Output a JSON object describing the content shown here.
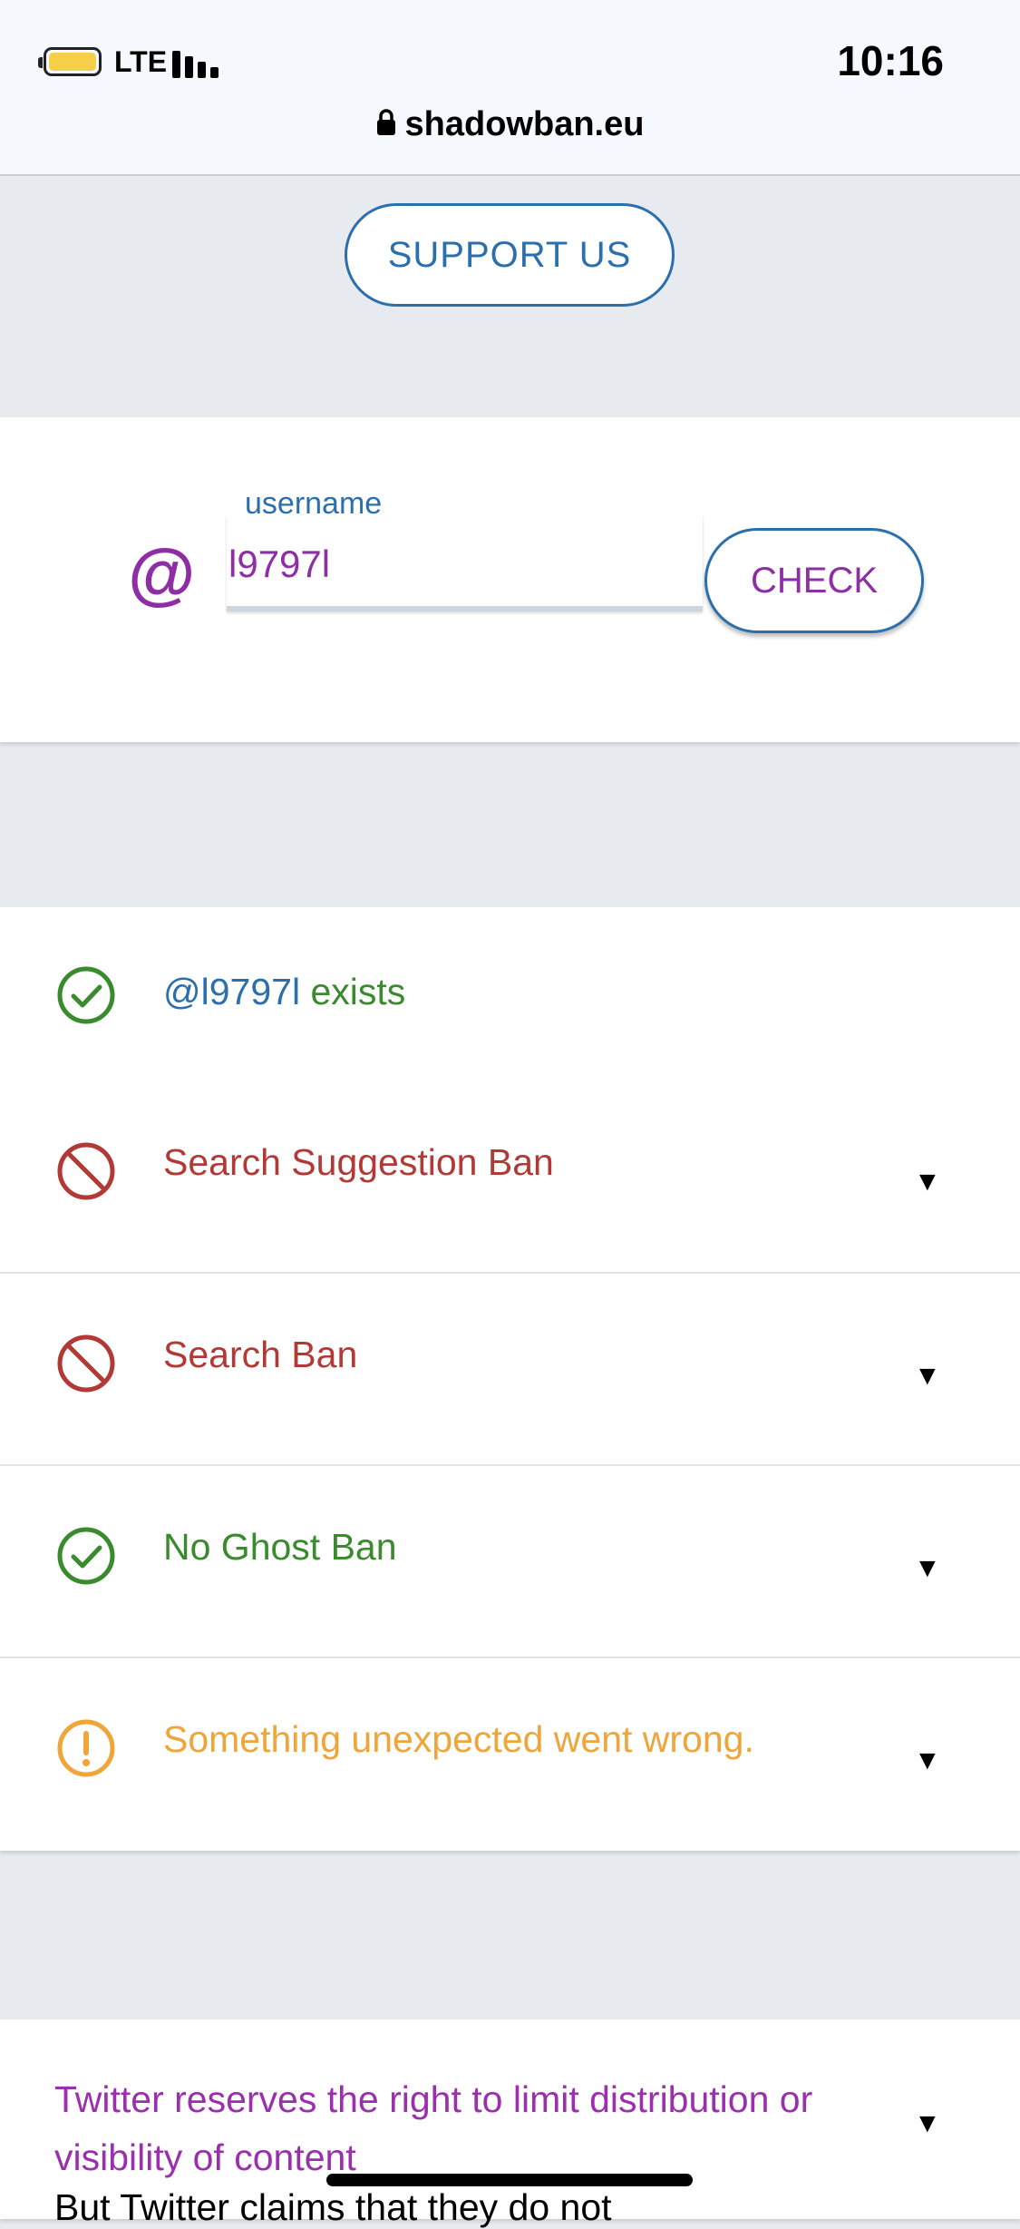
{
  "status_bar": {
    "carrier": "LTE",
    "time": "10:16"
  },
  "browser": {
    "url": "shadowban.eu"
  },
  "support_button": {
    "label": "SUPPORT US"
  },
  "username_form": {
    "at_symbol": "@",
    "field_label": "username",
    "value": "l9797l",
    "check_label": "CHECK"
  },
  "results": [
    {
      "label": "@l9797l exists",
      "status": "ok"
    },
    {
      "label": "Search Suggestion Ban",
      "status": "ban"
    },
    {
      "label": "Search Ban",
      "status": "ban"
    },
    {
      "label": "No Ghost Ban",
      "status": "ok"
    },
    {
      "label": "Something unexpected went wrong.",
      "status": "warning"
    }
  ],
  "exists_parts": {
    "handle": "@l9797l",
    "suffix": " exists"
  },
  "expand_arrow": "▼",
  "footer_card": {
    "text": "Twitter reserves the right to limit distribution or visibility of content",
    "subtext": "But Twitter claims that they do not"
  },
  "colors": {
    "ok": "#3a8a2e",
    "ban": "#b23a36",
    "warning": "#f0a53a",
    "accent_blue": "#2c6fad",
    "accent_purple": "#8e2ea6"
  }
}
